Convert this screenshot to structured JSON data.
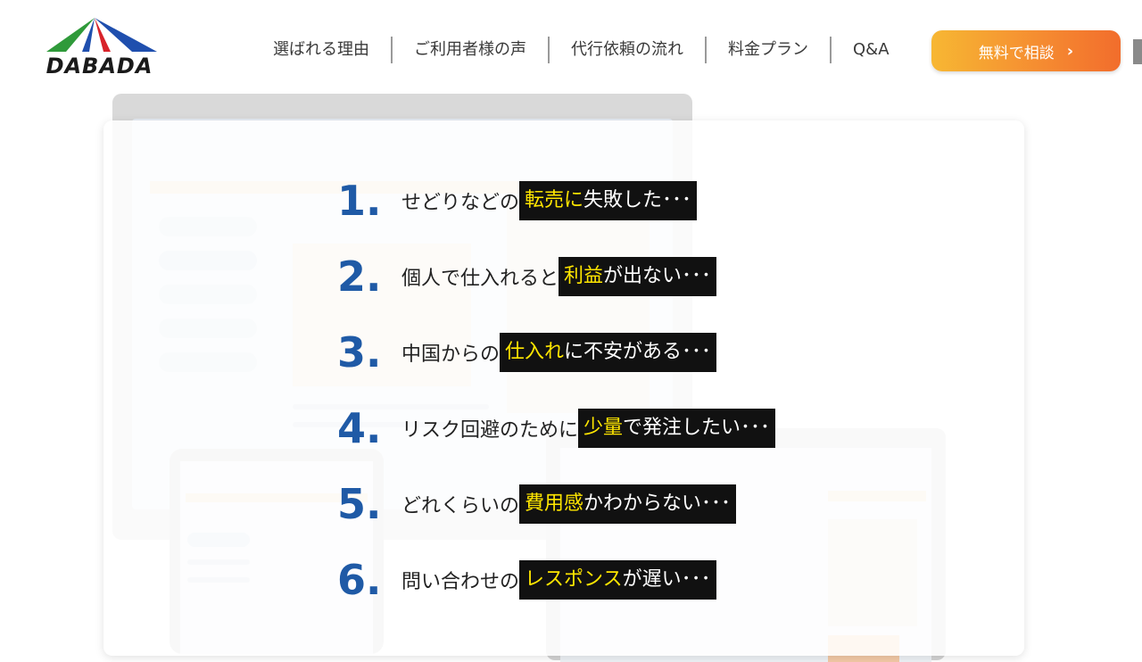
{
  "header": {
    "logo_text": "DABADA",
    "nav": [
      {
        "label": "選ばれる理由"
      },
      {
        "label": "ご利用者様の声"
      },
      {
        "label": "代行依頼の流れ"
      },
      {
        "label": "料金プラン"
      },
      {
        "label": "Q&A"
      }
    ],
    "cta_label": "無料で相談",
    "cta_icon": "chevron-right-icon"
  },
  "concerns": [
    {
      "num": "1.",
      "pre": "せどりなどの",
      "hl": "転売に",
      "post": "失敗した･･･"
    },
    {
      "num": "2.",
      "pre": "個人で仕入れると",
      "hl": "利益",
      "post": "が出ない･･･"
    },
    {
      "num": "3.",
      "pre": "中国からの",
      "hl": "仕入れ",
      "post": "に不安がある･･･"
    },
    {
      "num": "4.",
      "pre": "リスク回避のために",
      "hl": "少量",
      "post": "で発注したい･･･"
    },
    {
      "num": "5.",
      "pre": "どれくらいの",
      "hl": "費用感",
      "post": "かわからない･･･"
    },
    {
      "num": "6.",
      "pre": "問い合わせの",
      "hl": "レスポンス",
      "post": "が遅い･･･"
    }
  ],
  "colors": {
    "accent_blue": "#1f5aa6",
    "highlight_yellow": "#ffe600",
    "cta_orange": "#f58a31"
  }
}
